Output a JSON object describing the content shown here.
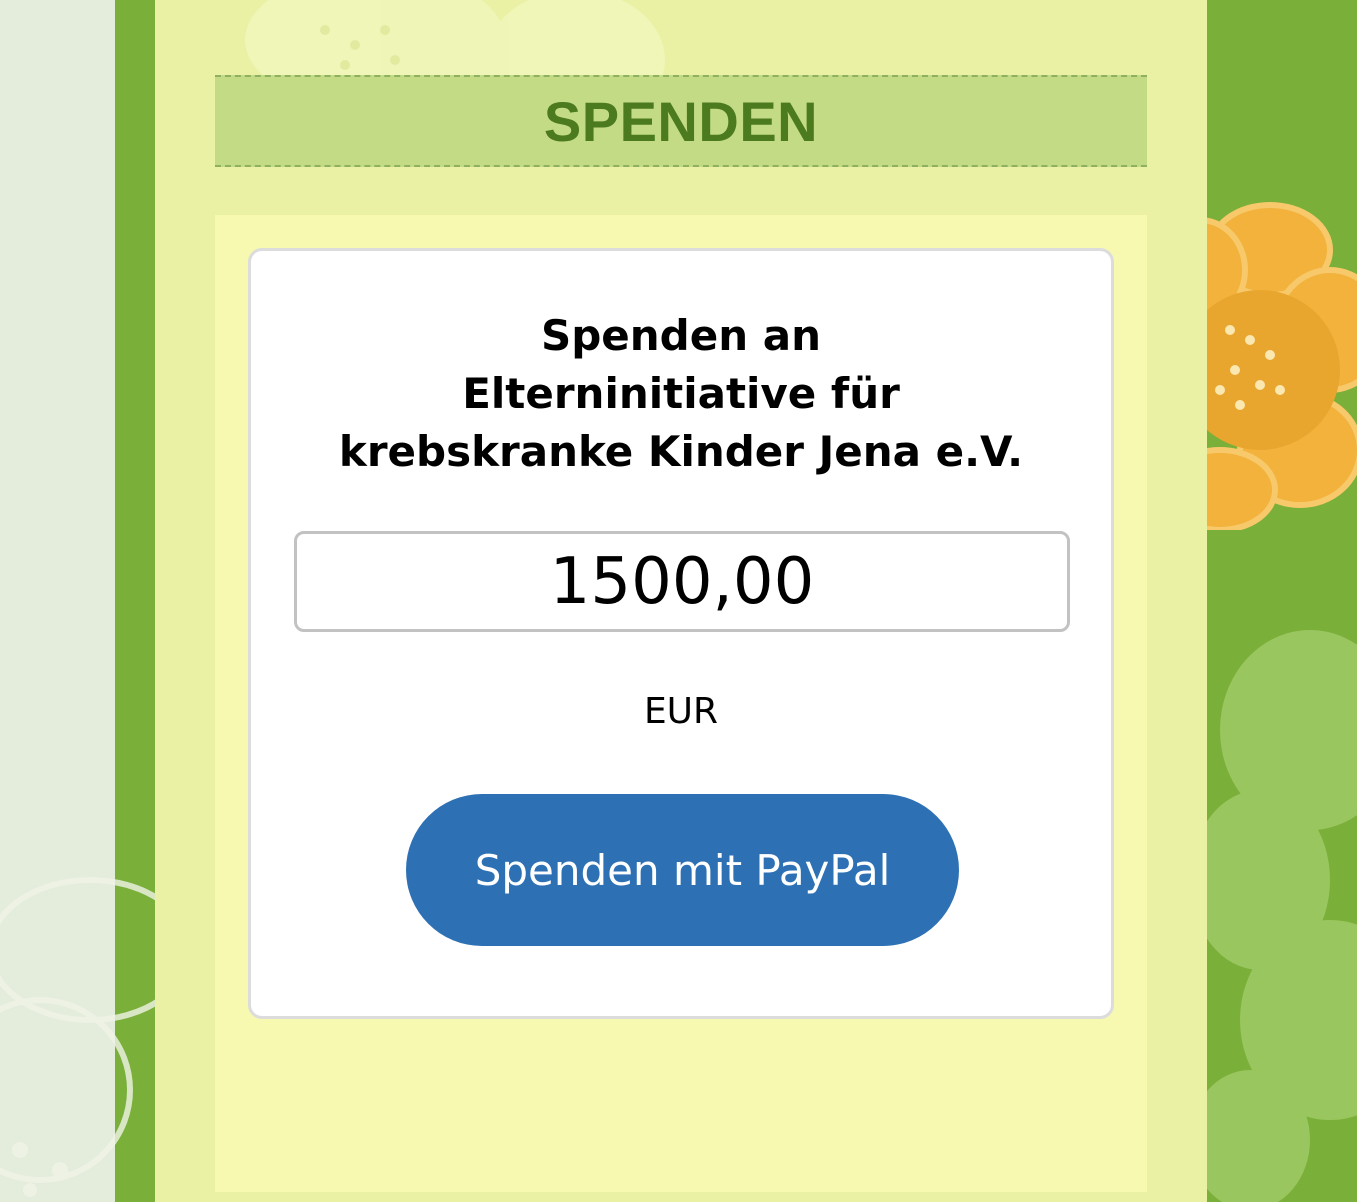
{
  "header": {
    "title": "SPENDEN"
  },
  "donation_card": {
    "title_lines": [
      "Spenden an",
      "Elterninitiative für",
      "krebskranke Kinder Jena e.V."
    ],
    "amount_value": "1500,00",
    "currency": "EUR",
    "button_label": "Spenden mit PayPal"
  },
  "colors": {
    "background_green": "#7aaf3a",
    "page_column": "#eaf1a4",
    "header_band": "#c3db84",
    "header_text": "#4c7a1f",
    "content_panel": "#f7f9b0",
    "paypal_blue": "#2d71b4",
    "flower_orange": "#f2b23c"
  },
  "decorations": {
    "icons": [
      "flower-decoration-icon"
    ]
  }
}
